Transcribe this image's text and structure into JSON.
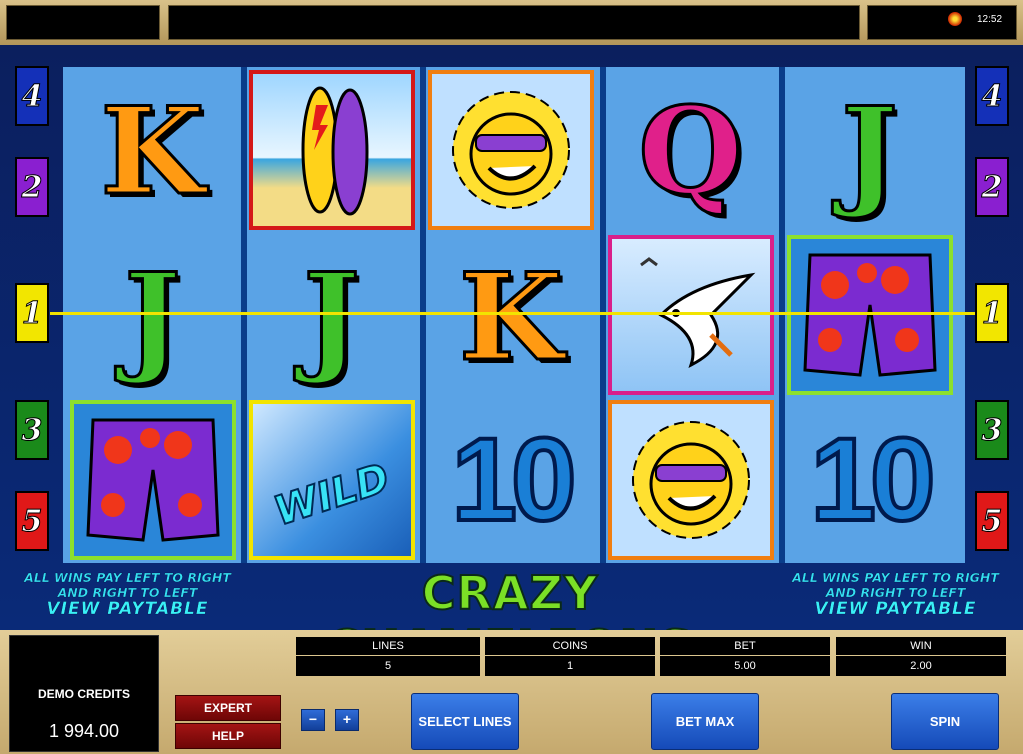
{
  "clock": {
    "time": "12:52"
  },
  "game": {
    "title": "CRAZY CHAMELEONS",
    "info_left": {
      "line1": "ALL WINS PAY LEFT TO RIGHT",
      "line2": "AND RIGHT TO LEFT",
      "paytable": "VIEW PAYTABLE"
    },
    "info_right": {
      "line1": "ALL WINS PAY LEFT TO RIGHT",
      "line2": "AND RIGHT TO LEFT",
      "paytable": "VIEW PAYTABLE"
    },
    "line_numbers_left": [
      "4",
      "2",
      "1",
      "3",
      "5"
    ],
    "line_numbers_right": [
      "4",
      "2",
      "1",
      "3",
      "5"
    ],
    "line_colors": {
      "4": "#1430b8",
      "2": "#8a1fd0",
      "1": "#f2e600",
      "3": "#1a8a1a",
      "5": "#e01818"
    },
    "symbols": {
      "k_top": "K",
      "q_top": "Q",
      "j_top": "J",
      "j_mid1": "J",
      "j_mid2": "J",
      "k_mid": "K",
      "ten_1": "10",
      "ten_2": "10",
      "wild": "WILD"
    }
  },
  "panel": {
    "credits_label": "DEMO CREDITS",
    "credits_value": "1 994.00",
    "expert_label": "EXPERT",
    "help_label": "HELP",
    "minus_label": "−",
    "plus_label": "+",
    "stats": [
      {
        "label": "LINES",
        "value": "5"
      },
      {
        "label": "COINS",
        "value": "1"
      },
      {
        "label": "BET",
        "value": "5.00"
      },
      {
        "label": "WIN",
        "value": "2.00"
      }
    ],
    "select_lines_label": "SELECT LINES",
    "bet_max_label": "BET MAX",
    "spin_label": "SPIN"
  }
}
